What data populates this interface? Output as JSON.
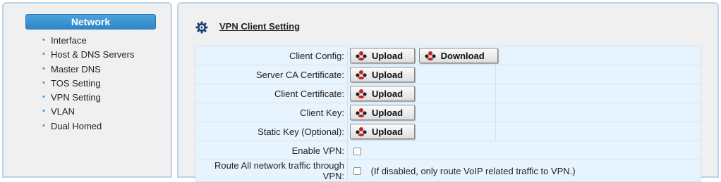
{
  "sidebar": {
    "header": "Network",
    "items": [
      {
        "label": "Interface"
      },
      {
        "label": "Host & DNS Servers"
      },
      {
        "label": "Master DNS"
      },
      {
        "label": "TOS Setting"
      },
      {
        "label": "VPN Setting"
      },
      {
        "label": "VLAN"
      },
      {
        "label": "Dual Homed"
      }
    ]
  },
  "main": {
    "title": "VPN Client Setting",
    "icon": "gear-icon",
    "rows": {
      "client_config": {
        "label": "Client Config:",
        "upload": "Upload",
        "download": "Download"
      },
      "server_ca": {
        "label": "Server CA Certificate:",
        "upload": "Upload"
      },
      "client_cert": {
        "label": "Client Certificate:",
        "upload": "Upload"
      },
      "client_key": {
        "label": "Client Key:",
        "upload": "Upload"
      },
      "static_key": {
        "label": "Static Key (Optional):",
        "upload": "Upload"
      },
      "enable_vpn": {
        "label": "Enable VPN:",
        "checked": false
      },
      "route_all": {
        "label": "Route All network traffic through VPN:",
        "checked": false,
        "note": "(If disabled, only route VoIP related traffic to VPN.)"
      }
    }
  },
  "colors": {
    "accent": "#2f86c8",
    "panel_border": "#bcd3ea",
    "table_bg": "#e8f4fd",
    "button_icon": "#cc1f1f"
  }
}
